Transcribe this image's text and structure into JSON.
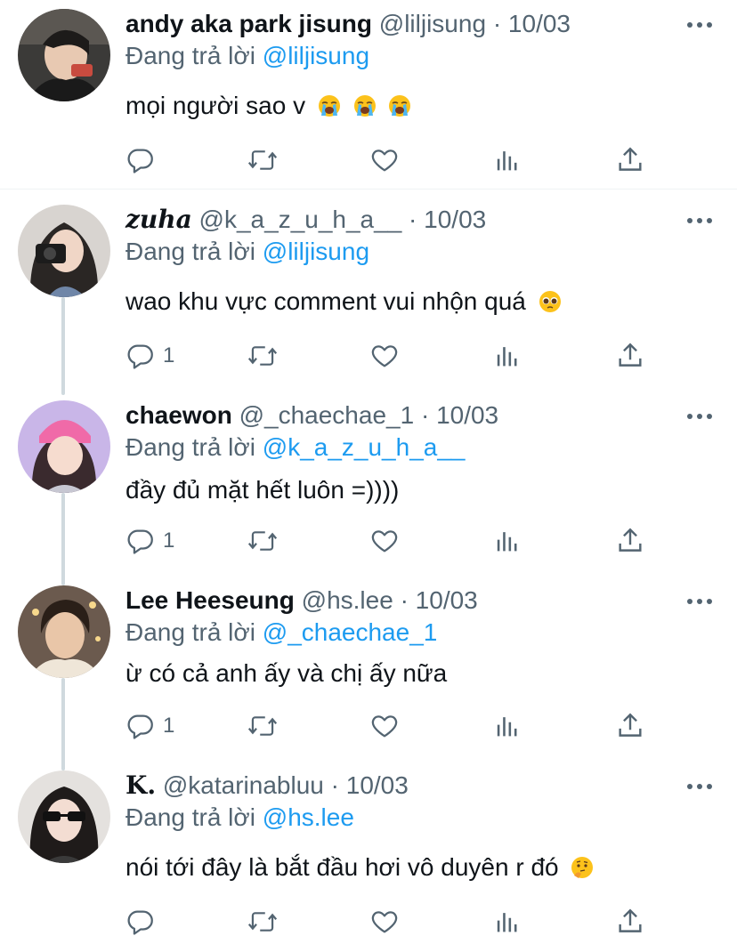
{
  "colors": {
    "text": "#0f1419",
    "secondary": "#536471",
    "link": "#1d9bf0",
    "thread_line": "#cfd9de"
  },
  "tweets": [
    {
      "name": "andy aka park jisung",
      "handle": "@liljisung",
      "sep": "·",
      "date": "10/03",
      "reply_prefix": "Đang trả lời",
      "reply_to": "@liljisung",
      "text": "mọi người sao v",
      "emojis": [
        "loudly-crying-face",
        "loudly-crying-face",
        "loudly-crying-face"
      ],
      "reply_count": ""
    },
    {
      "name": "zuha",
      "handle": "@k_a_z_u_h_a__",
      "sep": "·",
      "date": "10/03",
      "reply_prefix": "Đang trả lời",
      "reply_to": "@liljisung",
      "text": "wao khu vực comment vui nhộn quá",
      "emojis": [
        "pleading-face"
      ],
      "reply_count": "1"
    },
    {
      "name": "chaewon",
      "handle": "@_chaechae_1",
      "sep": "·",
      "date": "10/03",
      "reply_prefix": "Đang trả lời",
      "reply_to": "@k_a_z_u_h_a__",
      "text": "đầy đủ mặt hết luôn =))))",
      "emojis": [],
      "reply_count": "1"
    },
    {
      "name": "Lee Heeseung",
      "handle": "@hs.lee",
      "sep": "·",
      "date": "10/03",
      "reply_prefix": "Đang trả lời",
      "reply_to": "@_chaechae_1",
      "text": "ừ có cả anh ấy và chị ấy nữa",
      "emojis": [],
      "reply_count": "1"
    },
    {
      "name": "K.",
      "handle": "@katarinabluu",
      "sep": "·",
      "date": "10/03",
      "reply_prefix": "Đang trả lời",
      "reply_to": "@hs.lee",
      "text": "nói tới đây là bắt đầu hơi vô duyên r đó",
      "emojis": [
        "thinking-face"
      ],
      "reply_count": ""
    }
  ],
  "icons": {
    "reply": "reply-icon",
    "retweet": "retweet-icon",
    "like": "heart-icon",
    "views": "analytics-icon",
    "share": "share-icon",
    "more": "more-icon"
  }
}
